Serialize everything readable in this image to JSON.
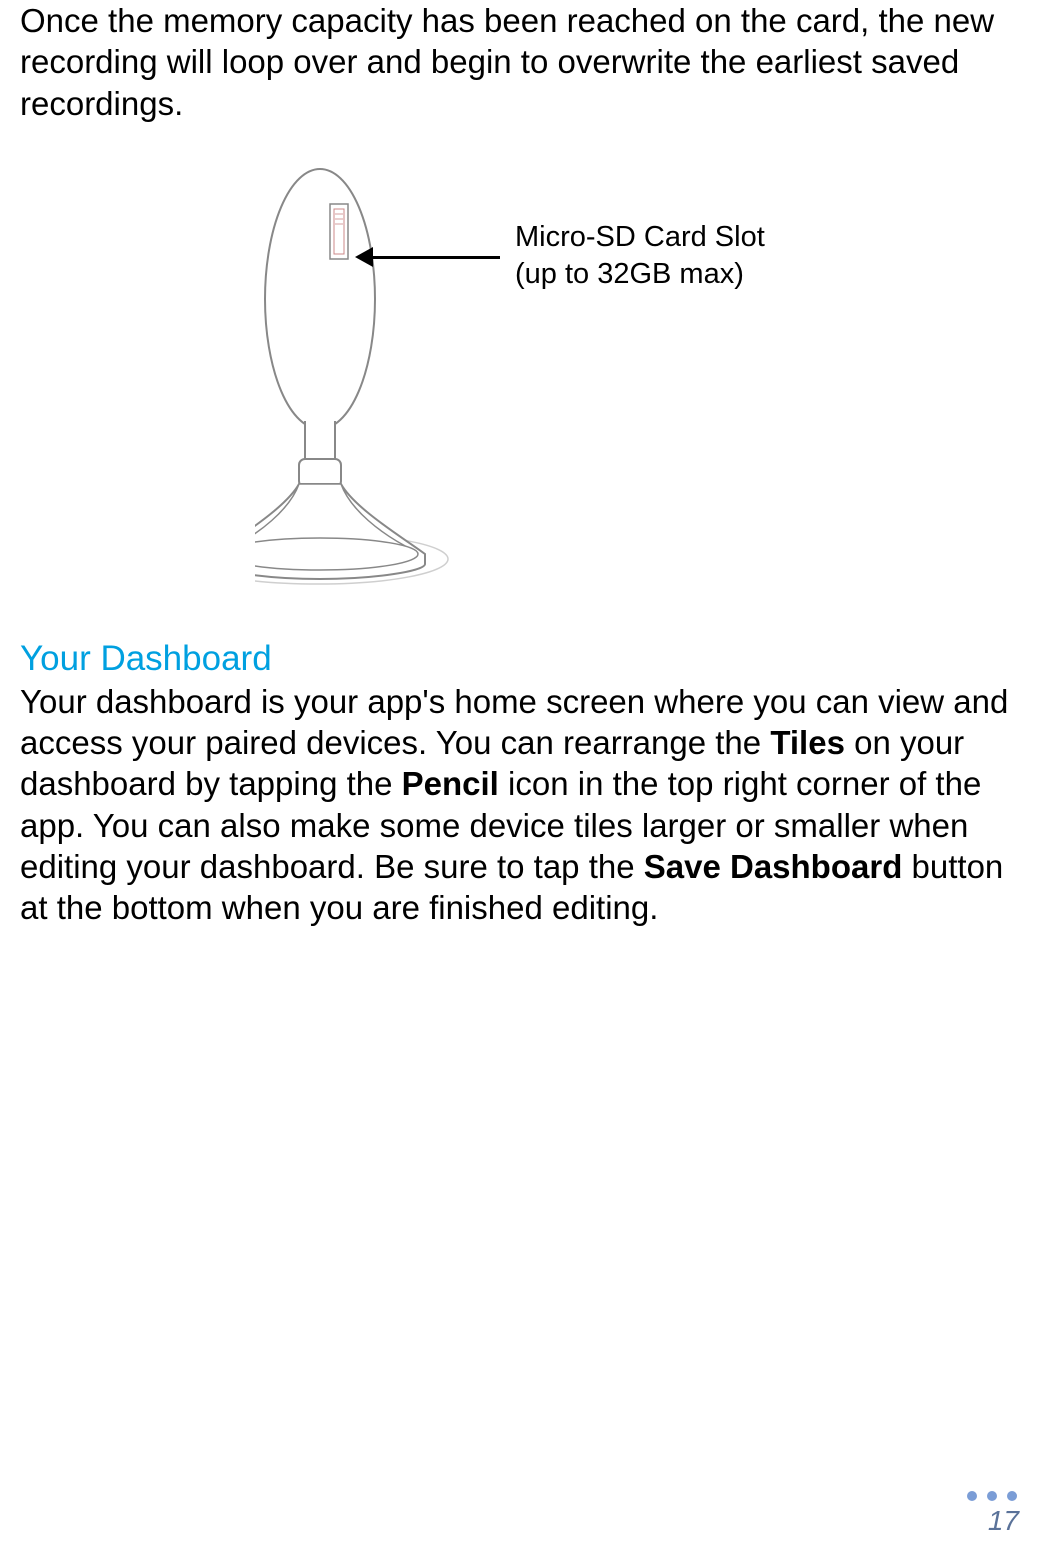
{
  "intro": "Once the memory capacity has been reached on the card, the new recording will loop over and begin to overwrite the earliest saved recordings.",
  "callout": {
    "line1": "Micro-SD Card Slot",
    "line2": "(up to 32GB max)"
  },
  "section": {
    "heading": "Your Dashboard",
    "p1_part1": "Your dashboard is your app's home screen where you can view and access your paired devices. You can rearrange the ",
    "p1_bold1": "Tiles",
    "p1_part2": " on your dashboard by tapping the ",
    "p1_bold2": "Pencil",
    "p1_part3": " icon in the top right corner of the app. You can also make some device tiles larger or smaller when editing your dashboard. Be sure to tap the ",
    "p1_bold3": "Save Dashboard",
    "p1_part4": " button at the bottom when you are finished editing."
  },
  "page_number": "17"
}
